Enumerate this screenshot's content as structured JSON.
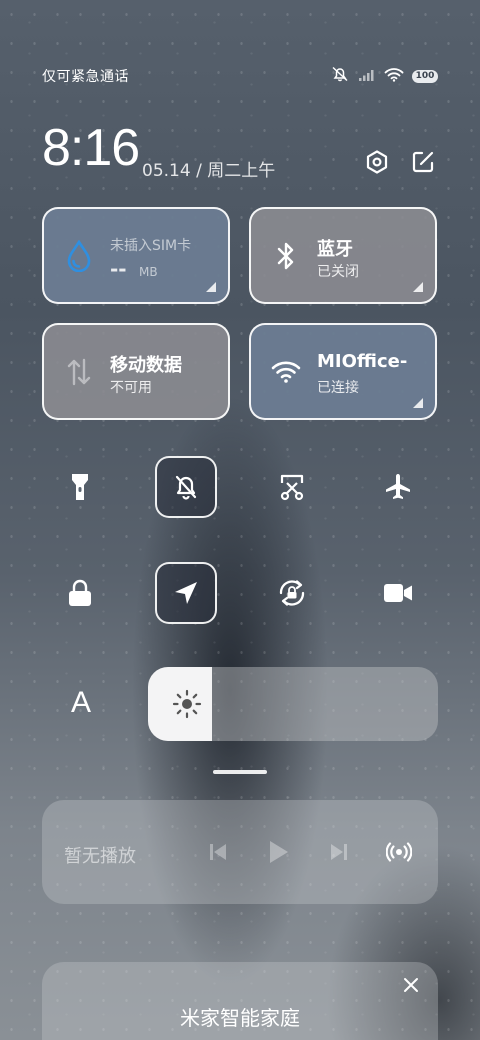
{
  "status_bar": {
    "carrier_text": "仅可紧急通话",
    "battery": "100"
  },
  "header": {
    "time": "8:16",
    "date": "05.14 / 周二上午"
  },
  "tiles": {
    "data_usage": {
      "title": "未插入SIM卡",
      "value": "--",
      "unit": "MB"
    },
    "bluetooth": {
      "title": "蓝牙",
      "status": "已关闭"
    },
    "mobile_data": {
      "title": "移动数据",
      "status": "不可用"
    },
    "wifi": {
      "title": "MIOffice-",
      "status": "已连接"
    }
  },
  "toggles": [
    {
      "name": "flashlight-icon",
      "active": false
    },
    {
      "name": "mute-icon",
      "active": true
    },
    {
      "name": "screenshot-icon",
      "active": false
    },
    {
      "name": "airplane-icon",
      "active": false
    },
    {
      "name": "lock-icon",
      "active": false
    },
    {
      "name": "location-icon",
      "active": true
    },
    {
      "name": "rotation-lock-icon",
      "active": false
    },
    {
      "name": "screen-record-icon",
      "active": false
    }
  ],
  "brightness": {
    "auto_label": "A",
    "level": 0.22
  },
  "media": {
    "label": "暂无播放"
  },
  "smart_home": {
    "title": "米家智能家庭"
  },
  "colors": {
    "tile_grey": "#8c8c92",
    "tile_blue": "#6c7c92",
    "water_drop": "#2f8fe0"
  }
}
